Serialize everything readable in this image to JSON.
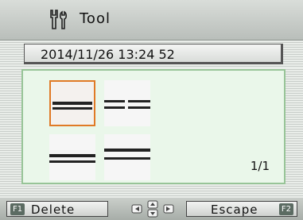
{
  "header": {
    "title": "Tool",
    "icon": "tool-icon"
  },
  "datetime": "2014/11/26 13:24 52",
  "grid": {
    "page": "1/1",
    "selected_index": 0,
    "thumbnails": [
      {
        "name": "thumbnail-1"
      },
      {
        "name": "thumbnail-2"
      },
      {
        "name": "thumbnail-3"
      },
      {
        "name": "thumbnail-4"
      }
    ]
  },
  "footer": {
    "f1_key": "F1",
    "f1_label": "Delete",
    "nav_icon": "direction-arrows-icon",
    "f2_key": "F2",
    "f2_label": "Escape"
  },
  "colors": {
    "selection": "#e07a26",
    "panel_bg": "#eaf7ea",
    "panel_border": "#97c497"
  }
}
